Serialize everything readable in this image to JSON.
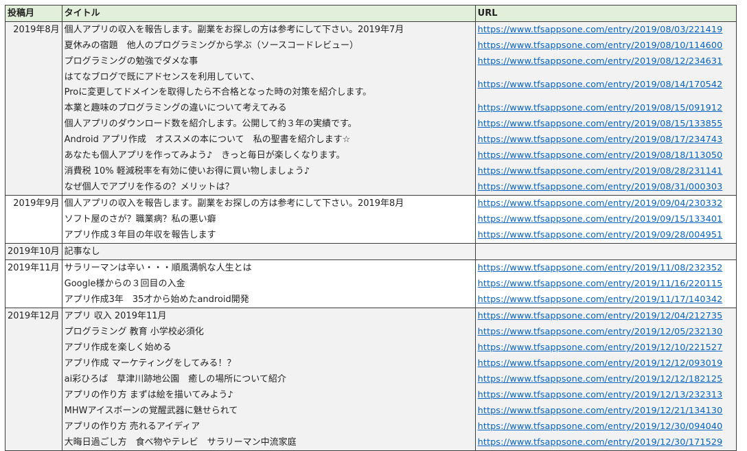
{
  "headers": {
    "month": "投稿月",
    "title": "タイトル",
    "url": "URL"
  },
  "groups": [
    {
      "month": "2019年8月",
      "shade": "grey",
      "rows": [
        {
          "title": "個人アプリの収入を報告します。副業をお探しの方は参考にして下さい。2019年7月",
          "url": "https://www.tfsappsone.com/entry/2019/08/03/221419"
        },
        {
          "title": "夏休みの宿題　他人のプログラミングから学ぶ（ソースコードレビュー）",
          "url": "https://www.tfsappsone.com/entry/2019/08/10/114600"
        },
        {
          "title": "プログラミングの勉強でダメな事",
          "url": "https://www.tfsappsone.com/entry/2019/08/12/234631"
        },
        {
          "title": "はてなブログで既にアドセンスを利用していて、",
          "title2": "Proに変更してドメインを取得したら不合格となった時の対策を紹介します。",
          "url": "https://www.tfsappsone.com/entry/2019/08/14/170542"
        },
        {
          "title": "本業と趣味のプログラミングの違いについて考えてみる",
          "url": "https://www.tfsappsone.com/entry/2019/08/15/091912"
        },
        {
          "title": "個人アプリのダウンロード数を紹介します。公開して約３年の実績です。",
          "url": "https://www.tfsappsone.com/entry/2019/08/15/133855"
        },
        {
          "title": "Android アプリ作成　オススメの本について　私の聖書を紹介します☆",
          "url": "https://www.tfsappsone.com/entry/2019/08/17/234743"
        },
        {
          "title": "あなたも個人アプリを作ってみよう♪　きっと毎日が楽しくなります。",
          "url": "https://www.tfsappsone.com/entry/2019/08/18/113050"
        },
        {
          "title": "消費税 10% 軽減税率を有効に使いお得に買い物しましょう♪",
          "url": "https://www.tfsappsone.com/entry/2019/08/28/231141"
        },
        {
          "title": "なぜ個人でアプリを作るの？メリットは？",
          "url": "https://www.tfsappsone.com/entry/2019/08/31/000303"
        }
      ]
    },
    {
      "month": "2019年9月",
      "shade": "white",
      "rows": [
        {
          "title": "個人アプリの収入を報告します。副業をお探しの方は参考にして下さい。2019年8月",
          "url": "https://www.tfsappsone.com/entry/2019/09/04/230332"
        },
        {
          "title": "ソフト屋のさが？職業病？私の悪い癖",
          "url": "https://www.tfsappsone.com/entry/2019/09/15/133401"
        },
        {
          "title": "アプリ作成３年目の年収を報告します",
          "url": "https://www.tfsappsone.com/entry/2019/09/28/004951"
        }
      ]
    },
    {
      "month": "2019年10月",
      "shade": "grey",
      "rows": [
        {
          "title": "記事なし",
          "url": ""
        }
      ]
    },
    {
      "month": "2019年11月",
      "shade": "white",
      "rows": [
        {
          "title": "サラリーマンは辛い・・・順風満帆な人生とは",
          "url": "https://www.tfsappsone.com/entry/2019/11/08/232352"
        },
        {
          "title": "Google様からの３回目の入金",
          "url": "https://www.tfsappsone.com/entry/2019/11/16/220115"
        },
        {
          "title": "アプリ作成3年　35才から始めたandroid開発",
          "url": "https://www.tfsappsone.com/entry/2019/11/17/140342"
        }
      ]
    },
    {
      "month": "2019年12月",
      "shade": "grey",
      "rows": [
        {
          "title": "アプリ 収入 2019年11月",
          "url": "https://www.tfsappsone.com/entry/2019/12/04/212735"
        },
        {
          "title": "プログラミング 教育 小学校必須化",
          "url": "https://www.tfsappsone.com/entry/2019/12/05/232130"
        },
        {
          "title": "アプリ作成を楽しく始める",
          "url": "https://www.tfsappsone.com/entry/2019/12/10/221527"
        },
        {
          "title": "アプリ作成 マーケティングをしてみる！？",
          "url": "https://www.tfsappsone.com/entry/2019/12/12/093019"
        },
        {
          "title": "ai彩ひろば　草津川跡地公園　癒しの場所について紹介",
          "url": "https://www.tfsappsone.com/entry/2019/12/12/182125"
        },
        {
          "title": "アプリの作り方 まずは絵を描いてみよう♪",
          "url": "https://www.tfsappsone.com/entry/2019/12/13/232313"
        },
        {
          "title": "MHWアイスボーンの覚醒武器に魅せられて",
          "url": "https://www.tfsappsone.com/entry/2019/12/21/134130"
        },
        {
          "title": "アプリの作り方 売れるアイディア",
          "url": "https://www.tfsappsone.com/entry/2019/12/30/094040"
        },
        {
          "title": "大晦日過ごし方　食べ物やテレビ　サラリーマン中流家庭",
          "url": "https://www.tfsappsone.com/entry/2019/12/30/171529"
        }
      ]
    }
  ]
}
